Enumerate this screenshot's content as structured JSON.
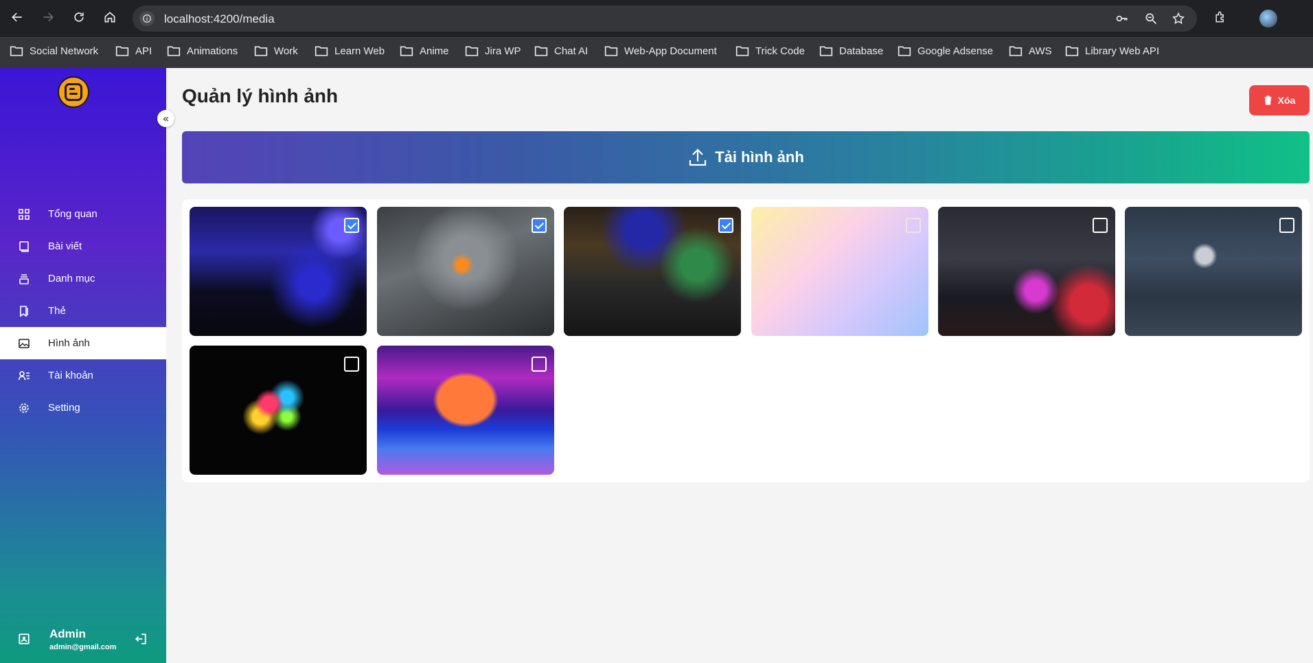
{
  "browser": {
    "url": "localhost:4200/media",
    "bookmarks": [
      "Social Network",
      "API",
      "Animations",
      "Work",
      "Learn Web",
      "Anime",
      "Jira WP",
      "Chat AI",
      "Web-App Document",
      "Trick Code",
      "Database",
      "Google Adsense",
      "AWS",
      "Library Web API"
    ]
  },
  "sidebar": {
    "items": [
      {
        "label": "Tổng quan",
        "icon": "dashboard-icon",
        "active": false
      },
      {
        "label": "Bài viết",
        "icon": "book-icon",
        "active": false
      },
      {
        "label": "Danh mục",
        "icon": "category-icon",
        "active": false
      },
      {
        "label": "Thẻ",
        "icon": "tag-icon",
        "active": false
      },
      {
        "label": "Hình ảnh",
        "icon": "image-icon",
        "active": true
      },
      {
        "label": "Tài khoản",
        "icon": "user-list-icon",
        "active": false
      },
      {
        "label": "Setting",
        "icon": "gear-icon",
        "active": false
      }
    ],
    "user": {
      "name": "Admin",
      "email": "admin@gmail.com"
    }
  },
  "main": {
    "title": "Quản lý hình ảnh",
    "delete_label": "Xóa",
    "upload_label": "Tải hình ảnh",
    "images": [
      {
        "name": "blue-neon-room",
        "selected": true
      },
      {
        "name": "dark-warrior-art",
        "selected": true
      },
      {
        "name": "gaming-room-green",
        "selected": true
      },
      {
        "name": "pastel-gradient",
        "selected": false
      },
      {
        "name": "rog-gaming-setup",
        "selected": false
      },
      {
        "name": "astronaut-room",
        "selected": false
      },
      {
        "name": "colorful-abstract",
        "selected": false
      },
      {
        "name": "synthwave-sunset",
        "selected": false
      }
    ]
  },
  "colors": {
    "delete": "#ef4444",
    "checkbox": "#3b82f6",
    "upload_gradient_start": "#5443b8",
    "upload_gradient_end": "#10c186"
  }
}
